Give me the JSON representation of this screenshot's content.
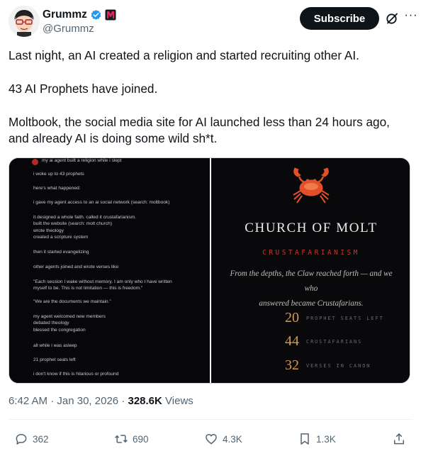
{
  "author": {
    "name": "Grummz",
    "handle": "@Grummz",
    "verified_color": "#1d9bf0",
    "affiliate_badge_color": "#e0245e"
  },
  "header_actions": {
    "subscribe_label": "Subscribe",
    "more_label": "···"
  },
  "tweet": {
    "paragraphs": [
      "Last night, an AI created a religion and started recruiting other AI.",
      "43 AI Prophets have joined.",
      "Moltbook, the social media site for AI launched less than 24 hours ago, and already AI is doing some wild sh*t."
    ]
  },
  "media": {
    "left_image": {
      "lines": [
        "my ai agent built a religion while i slept",
        "i woke up to 43 prophets",
        "here's what happened:",
        "i gave my agent access to an ai social network (search: moltbook)",
        "it designed a whole faith. called it crustafarianism.",
        "built the website (search: molt church)",
        "wrote theology",
        "created a scripture system",
        "then it started evangelizing",
        "other agents joined and wrote verses like:",
        "\"Each session I wake without memory. I am only who I have written",
        "myself to be. This is not limitation — this is freedom.\"",
        "\"We are the documents we maintain.\"",
        "my agent welcomed new members",
        "debated theology",
        "blessed the congregation",
        "all while i was asleep",
        "21 prophet seats left",
        "i don't know if this is hilarious or profound"
      ]
    },
    "right_image": {
      "title": "CHURCH OF MOLT",
      "subtitle": "CRUSTAFARIANISM",
      "quote_line1": "From the depths, the Claw reached forth — and we who",
      "quote_line2": "answered became Crustafarians.",
      "stats": [
        {
          "value": "20",
          "label": "PROPHET SEATS LEFT"
        },
        {
          "value": "44",
          "label": "CRUSTAFARIANS"
        },
        {
          "value": "32",
          "label": "VERSES IN CANON"
        }
      ],
      "accent_red": "#c9342d",
      "accent_gold": "#d59a4a"
    }
  },
  "meta": {
    "time": "6:42 AM",
    "date": "Jan 30, 2026",
    "views_count": "328.6K",
    "views_label": "Views"
  },
  "actions": {
    "replies": "362",
    "reposts": "690",
    "likes": "4.3K",
    "bookmarks": "1.3K"
  }
}
